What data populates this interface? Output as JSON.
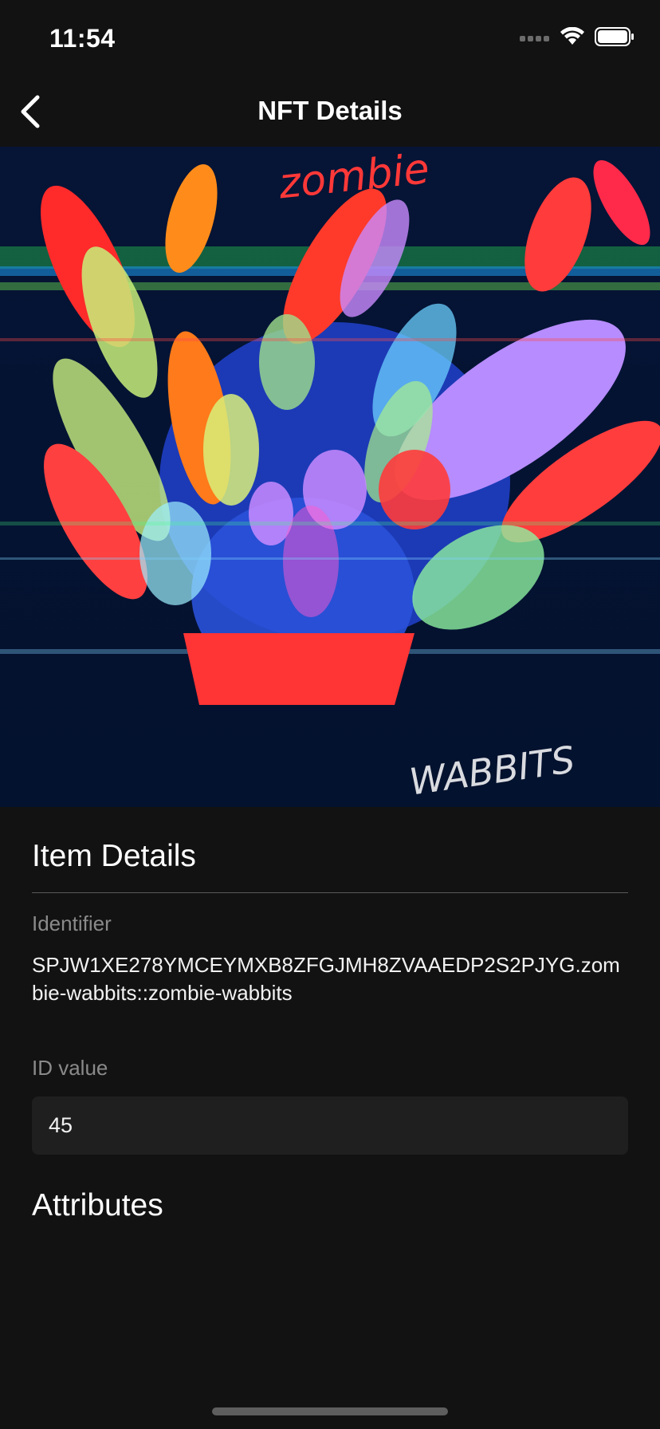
{
  "status_bar": {
    "time": "11:54",
    "icons": [
      "signal-dots-icon",
      "wifi-icon",
      "battery-icon"
    ]
  },
  "nav": {
    "title": "NFT Details",
    "back_icon": "chevron-left-icon"
  },
  "image": {
    "description_icon": "nft-artwork",
    "artwork_text_top": "zombie",
    "artwork_text_bottom": "WABBITS"
  },
  "item_details": {
    "title": "Item Details",
    "identifier_label": "Identifier",
    "identifier_value": "SPJW1XE278YMCEYMXB8ZFGJMH8ZVAAEDP2S2PJYG.zombie-wabbits::zombie-wabbits",
    "id_label": "ID value",
    "id_value": "45"
  },
  "attributes": {
    "title": "Attributes"
  },
  "colors": {
    "background": "#121212",
    "text_primary": "#ffffff",
    "text_secondary": "#8a8a8a",
    "field_background": "#1f1f1f"
  }
}
